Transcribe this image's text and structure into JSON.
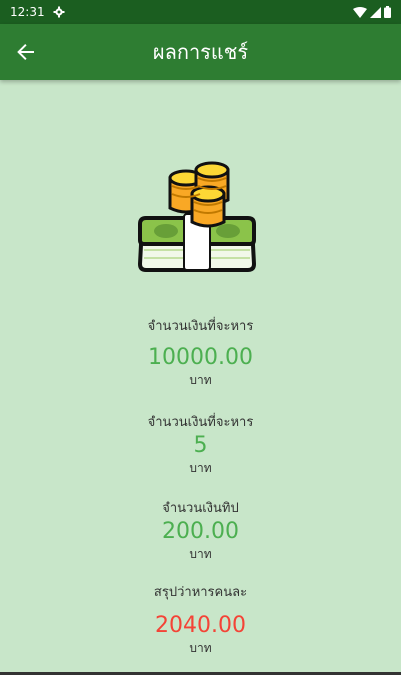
{
  "status_bar": {
    "time": "12:31",
    "bg_color": "#1b5e20",
    "icons": [
      "settings-icon",
      "wifi-icon",
      "signal-icon",
      "battery-icon"
    ]
  },
  "app_bar": {
    "title": "ผลการแชร์",
    "back_icon": "arrow-left-icon",
    "color": "#2e7d32"
  },
  "main": {
    "image": "money-stack-with-gold-coins",
    "total_label": "จำนวนเงินที่จะหาร",
    "total_value": "10000.00",
    "total_unit": "บาท",
    "divisor_label": "จำนวนเงินที่จะหาร",
    "divisor_value": "5",
    "divisor_unit": "บาท",
    "tip_label": "จำนวนเงินทิป",
    "tip_value": "200.00",
    "tip_unit": "บาท",
    "summary_label": "สรุปว่าหารคนละ",
    "summary_value": "2040.00",
    "summary_unit": "บาท"
  },
  "colors": {
    "background": "#c8e6c9",
    "value_green": "#4caf50",
    "value_red": "#f44336"
  }
}
